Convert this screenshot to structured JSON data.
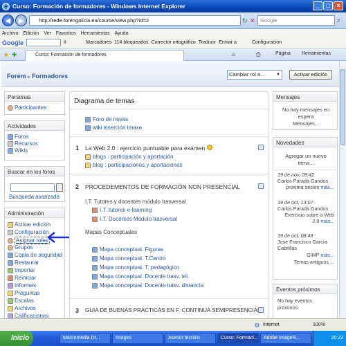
{
  "window": {
    "title": "Curso: Formación de formadores - Windows Internet Explorer"
  },
  "address": {
    "url": "http://rede.forengalicia.eu/course/view.php?id=2",
    "search_placeholder": "Google"
  },
  "menu": [
    "Archivo",
    "Edición",
    "Ver",
    "Favoritos",
    "Herramientas",
    "Ayuda"
  ],
  "gtoolbar": {
    "brand": "Google",
    "items": [
      "Ir",
      "Marcadores",
      "114 bloqueados",
      "Corrector ortográfico",
      "Traducir",
      "Enviar a",
      "Configuración"
    ]
  },
  "tab": {
    "label": "Curso: Formación de formadores",
    "page": "Página",
    "tools": "Herramientas"
  },
  "navbar": {
    "crumb_home": "Forem",
    "crumb_sep": "▸",
    "crumb_current": "Formadores",
    "role_select": "Cambiar rol a...",
    "edit_button": "Activar edición"
  },
  "left": {
    "people": {
      "title": "Personas",
      "items": [
        "Participantes"
      ]
    },
    "activities": {
      "title": "Actividades",
      "items": [
        "Foros",
        "Recursos",
        "Wikis"
      ]
    },
    "forum_search": {
      "title": "Buscar en los foros",
      "advanced": "Búsqueda avanzada"
    },
    "admin": {
      "title": "Administración",
      "items": [
        "Activar edición",
        "Configuración",
        "Asignar roles",
        "Grupos",
        "Copia de seguridad",
        "Restaurar",
        "Importar",
        "Reiniciar",
        "Informes",
        "Preguntas",
        "Escalas",
        "Archivos",
        "Calificaciones"
      ]
    }
  },
  "center": {
    "title": "Diagrama de temas",
    "topic0": {
      "items": [
        "Foro de novas",
        "wiki inserción imaxe"
      ]
    },
    "topic1": {
      "num": "1",
      "title": "La Web 2.0 : ejercicio puntuable para examen",
      "items": [
        "blogs : participación y aportación",
        "blog : participaciones y aportaciones"
      ]
    },
    "topic2": {
      "num": "2",
      "title": "PROCEDEMENTOS DE FORMACIÓN NON PRESENCIAL",
      "sub1": "I.T. Tutores y docentes módulo trasversal",
      "sub1_items": [
        "I.T. tutores e-learning",
        "I.T. Docentes Módulo trasversal"
      ],
      "sub2": "Mapas Conceptuales",
      "sub2_items": [
        "Mapa conceptual. Figuras",
        "Mapa conceptual. T.Centro",
        "Mapa conceptual. T. pedagógico",
        "Mapa conceptual. Docente trasv. tel.",
        "Mapa conceptual. Docente trasv. distancia"
      ]
    },
    "topic3": {
      "num": "3",
      "title": "GUIA DE BUENAS PRÁCTICAS  EN F. CONTINUA SEMIPRESENCIAL"
    }
  },
  "right": {
    "messages": {
      "title": "Mensajes",
      "text1": "No hay mensajes en",
      "text2": "espera",
      "link": "Mensajes..."
    },
    "news": {
      "title": "Novedades",
      "add_link1": "Agregar un nuevo",
      "add_link2": "tema...",
      "posts": [
        {
          "date": "19 de nov, 09:42",
          "author": "Carlos Parada Gandos",
          "text": "proxima sesion",
          "more": "más..."
        },
        {
          "date": "19 de oct, 13:07",
          "author": "Carlos Parada Gandos",
          "text": "Exercicio sobre a Web 2.0",
          "more": "más..."
        },
        {
          "date": "19 de oct, 08:48",
          "author": "Jose Francisco García Cabrillas",
          "text": "GIMP",
          "more": "más..."
        }
      ],
      "older": "Temas antiguos ..."
    },
    "events": {
      "title": "Eventos próximos",
      "text1": "No hay eventos",
      "text2": "próximos"
    }
  },
  "status": {
    "zone": "Internet",
    "zoom": "100%"
  },
  "taskbar": {
    "start": "Inicio",
    "tasks": [
      "Macromedia Dr...",
      "Images",
      "Asesor tecnico",
      "Curso: Formaci...",
      "Adobe ImageR..."
    ],
    "clock": "20:22"
  },
  "colors": {
    "link": "#2a55a5",
    "arrow": "#1b2fd6",
    "titlebar": "#0a47b8"
  }
}
